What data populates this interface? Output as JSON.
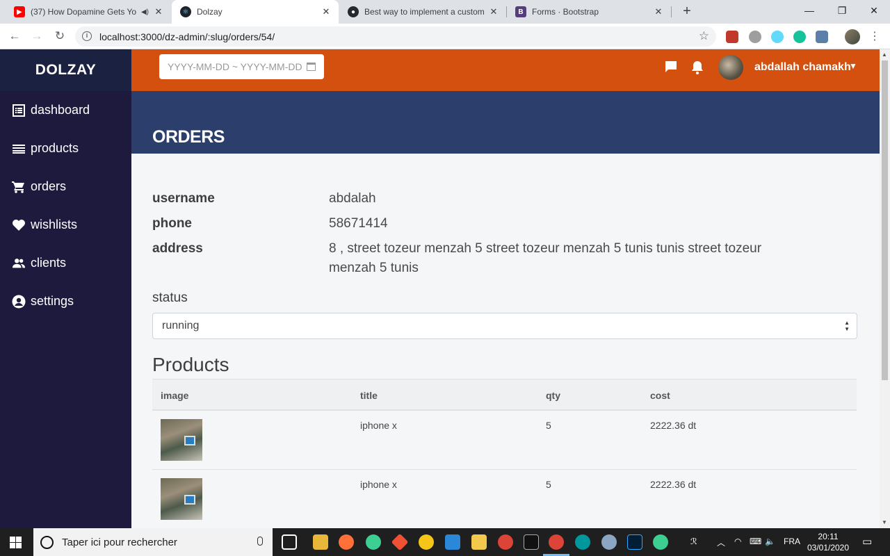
{
  "browser": {
    "tabs": [
      {
        "title": "(37) How Dopamine Gets Yo",
        "icon": "youtube-icon",
        "active": false
      },
      {
        "title": "Dolzay",
        "icon": "react-icon",
        "active": true
      },
      {
        "title": "Best way to implement a custom",
        "icon": "github-icon",
        "active": false
      },
      {
        "title": "Forms · Bootstrap",
        "icon": "bootstrap-icon",
        "active": false
      }
    ],
    "url": "localhost:3000/dz-admin/:slug/orders/54/"
  },
  "brand": "DOLZAY",
  "sidebar": {
    "items": [
      {
        "label": "dashboard",
        "icon": "list-icon"
      },
      {
        "label": "products",
        "icon": "lines-icon"
      },
      {
        "label": "orders",
        "icon": "cart-icon"
      },
      {
        "label": "wishlists",
        "icon": "heart-icon"
      },
      {
        "label": "clients",
        "icon": "people-icon"
      },
      {
        "label": "settings",
        "icon": "user-circle-icon"
      }
    ]
  },
  "topbar": {
    "date_placeholder": "YYYY-MM-DD ~ YYYY-MM-DD",
    "user_name": "abdallah chamakh"
  },
  "page": {
    "title": "ORDERS",
    "order": {
      "username_label": "username",
      "username": "abdalah",
      "phone_label": "phone",
      "phone": "58671414",
      "address_label": "address",
      "address": "8 , street tozeur menzah 5 street tozeur menzah 5 tunis tunis street tozeur menzah 5 tunis"
    },
    "status_label": "status",
    "status_value": "running",
    "products_heading": "Products",
    "table": {
      "columns": [
        "image",
        "title",
        "qty",
        "cost"
      ],
      "rows": [
        {
          "title": "iphone x",
          "qty": "5",
          "cost": "2222.36 dt"
        },
        {
          "title": "iphone x",
          "qty": "5",
          "cost": "2222.36 dt"
        }
      ]
    }
  },
  "taskbar": {
    "search_placeholder": "Taper ici pour rechercher",
    "language": "FRA",
    "time": "20:11",
    "date": "03/01/2020"
  },
  "colors": {
    "sidebar": "#1d1a3e",
    "topbar": "#d4500f",
    "banner": "#2c3e6b"
  }
}
